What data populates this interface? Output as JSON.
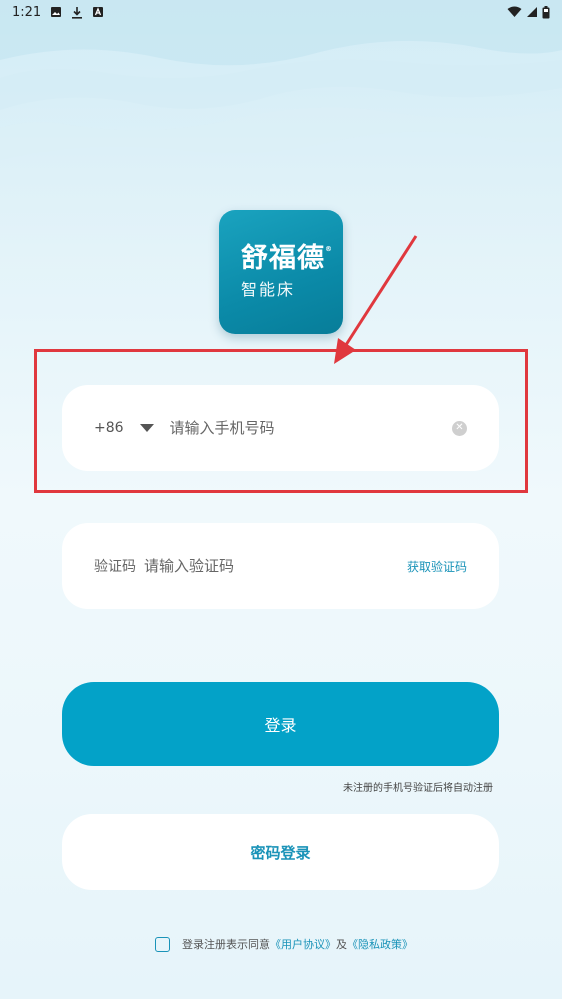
{
  "status_bar": {
    "time": "1:21",
    "left_icons": [
      "image-icon",
      "download-icon",
      "font-a-icon"
    ],
    "right_icons": [
      "wifi-icon",
      "signal-icon",
      "battery-icon"
    ]
  },
  "logo": {
    "main": "舒福德",
    "registered": "®",
    "sub": "智能床"
  },
  "phone": {
    "country_code": "+86",
    "placeholder": "请输入手机号码"
  },
  "code": {
    "label": "验证码",
    "placeholder": "请输入验证码",
    "get_code": "获取验证码"
  },
  "login_button": "登录",
  "auto_register_note": "未注册的手机号验证后将自动注册",
  "password_login_button": "密码登录",
  "agreement": {
    "prefix": "登录注册表示同意",
    "user_agreement": "《用户协议》",
    "and": "及",
    "privacy_policy": "《隐私政策》"
  },
  "colors": {
    "accent": "#03a2c8",
    "link": "#1a93b8",
    "annotation_red": "#e0383e"
  }
}
